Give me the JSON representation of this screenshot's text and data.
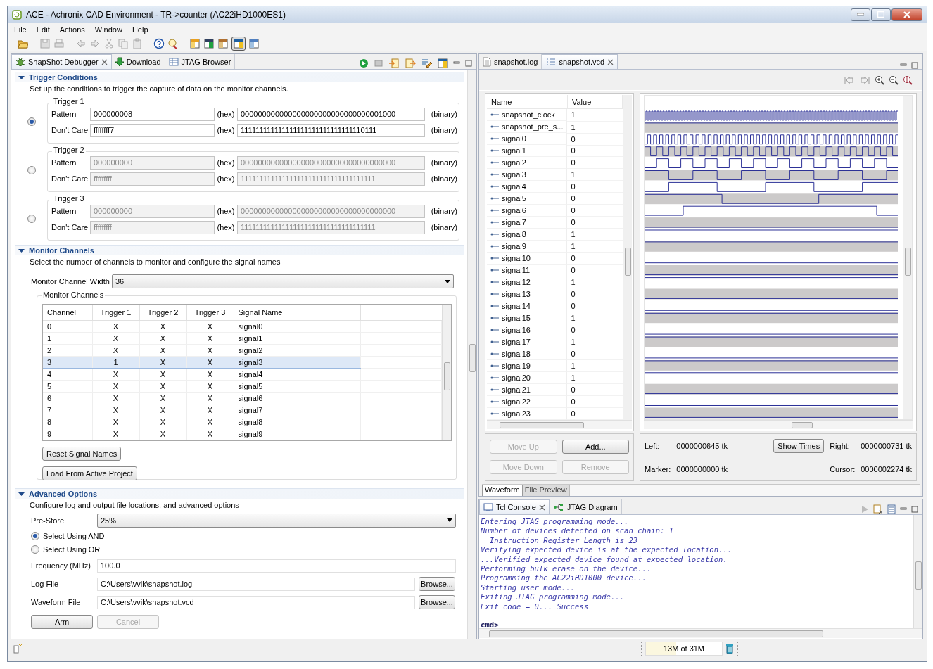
{
  "window": {
    "title": "ACE - Achronix CAD Environment - TR->counter (AC22iHD1000ES1)"
  },
  "menu": [
    "File",
    "Edit",
    "Actions",
    "Window",
    "Help"
  ],
  "left_tabs": [
    {
      "label": "SnapShot Debugger",
      "selected": true,
      "closable": true
    },
    {
      "label": "Download",
      "selected": false,
      "closable": false
    },
    {
      "label": "JTAG Browser",
      "selected": false,
      "closable": false
    }
  ],
  "trigger_conditions": {
    "title": "Trigger Conditions",
    "expanded": true,
    "description": "Set up the conditions to trigger the capture of data on the monitor channels.",
    "triggers": [
      {
        "label": "Trigger 1",
        "selected": true,
        "disabled": false,
        "rows": [
          {
            "label": "Pattern",
            "hex": "000000008",
            "hex_unit": "(hex)",
            "binary": "000000000000000000000000000000001000",
            "binary_unit": "(binary)"
          },
          {
            "label": "Don't Care",
            "hex": "ffffffff7",
            "hex_unit": "(hex)",
            "binary": "111111111111111111111111111111110111",
            "binary_unit": "(binary)"
          }
        ]
      },
      {
        "label": "Trigger 2",
        "selected": false,
        "disabled": true,
        "rows": [
          {
            "label": "Pattern",
            "hex": "000000000",
            "hex_unit": "(hex)",
            "binary": "000000000000000000000000000000000000",
            "binary_unit": "(binary)"
          },
          {
            "label": "Don't Care",
            "hex": "fffffffff",
            "hex_unit": "(hex)",
            "binary": "111111111111111111111111111111111111",
            "binary_unit": "(binary)"
          }
        ]
      },
      {
        "label": "Trigger 3",
        "selected": false,
        "disabled": true,
        "rows": [
          {
            "label": "Pattern",
            "hex": "000000000",
            "hex_unit": "(hex)",
            "binary": "000000000000000000000000000000000000",
            "binary_unit": "(binary)"
          },
          {
            "label": "Don't Care",
            "hex": "fffffffff",
            "hex_unit": "(hex)",
            "binary": "111111111111111111111111111111111111",
            "binary_unit": "(binary)"
          }
        ]
      }
    ]
  },
  "monitor_channels": {
    "title": "Monitor Channels",
    "expanded": true,
    "description": "Select the number of channels to monitor and configure the signal names",
    "width_label": "Monitor Channel Width",
    "width_value": "36",
    "group_title": "Monitor Channels",
    "table": {
      "columns": [
        "Channel",
        "Trigger 1",
        "Trigger 2",
        "Trigger 3",
        "Signal Name"
      ],
      "rows": [
        {
          "cells": [
            "0",
            "X",
            "X",
            "X",
            "signal0"
          ],
          "selected": false
        },
        {
          "cells": [
            "1",
            "X",
            "X",
            "X",
            "signal1"
          ],
          "selected": false
        },
        {
          "cells": [
            "2",
            "X",
            "X",
            "X",
            "signal2"
          ],
          "selected": false
        },
        {
          "cells": [
            "3",
            "1",
            "X",
            "X",
            "signal3"
          ],
          "selected": true
        },
        {
          "cells": [
            "4",
            "X",
            "X",
            "X",
            "signal4"
          ],
          "selected": false
        },
        {
          "cells": [
            "5",
            "X",
            "X",
            "X",
            "signal5"
          ],
          "selected": false
        },
        {
          "cells": [
            "6",
            "X",
            "X",
            "X",
            "signal6"
          ],
          "selected": false
        },
        {
          "cells": [
            "7",
            "X",
            "X",
            "X",
            "signal7"
          ],
          "selected": false
        },
        {
          "cells": [
            "8",
            "X",
            "X",
            "X",
            "signal8"
          ],
          "selected": false
        },
        {
          "cells": [
            "9",
            "X",
            "X",
            "X",
            "signal9"
          ],
          "selected": false
        }
      ]
    },
    "buttons": [
      "Reset Signal Names",
      "Load From Active Project"
    ]
  },
  "advanced_options": {
    "title": "Advanced Options",
    "expanded": true,
    "description": "Configure log and output file locations, and advanced options",
    "prestore_label": "Pre-Store",
    "prestore_value": "25%",
    "modes": [
      {
        "label": "Select Using AND",
        "selected": true
      },
      {
        "label": "Select Using OR",
        "selected": false
      }
    ],
    "fields": [
      {
        "label": "Frequency (MHz)",
        "value": "100.0"
      },
      {
        "label": "Log File",
        "value": "C:\\Users\\vvik\\snapshot.log",
        "button": "Browse..."
      },
      {
        "label": "Waveform File",
        "value": "C:\\Users\\vvik\\snapshot.vcd",
        "button": "Browse..."
      }
    ],
    "buttons": [
      {
        "label": "Arm",
        "disabled": false
      },
      {
        "label": "Cancel",
        "disabled": true
      }
    ]
  },
  "editor_tabs": [
    {
      "label": "snapshot.log",
      "selected": false,
      "closable": false
    },
    {
      "label": "snapshot.vcd",
      "selected": true,
      "closable": true
    }
  ],
  "signals": {
    "columns": [
      "Name",
      "Value"
    ],
    "rows": [
      {
        "name": "snapshot_clock",
        "value": "1"
      },
      {
        "name": "snapshot_pre_s...",
        "value": "1"
      },
      {
        "name": "signal0",
        "value": "0"
      },
      {
        "name": "signal1",
        "value": "0"
      },
      {
        "name": "signal2",
        "value": "0"
      },
      {
        "name": "signal3",
        "value": "1"
      },
      {
        "name": "signal4",
        "value": "0"
      },
      {
        "name": "signal5",
        "value": "0"
      },
      {
        "name": "signal6",
        "value": "0"
      },
      {
        "name": "signal7",
        "value": "0"
      },
      {
        "name": "signal8",
        "value": "1"
      },
      {
        "name": "signal9",
        "value": "1"
      },
      {
        "name": "signal10",
        "value": "0"
      },
      {
        "name": "signal11",
        "value": "0"
      },
      {
        "name": "signal12",
        "value": "1"
      },
      {
        "name": "signal13",
        "value": "0"
      },
      {
        "name": "signal14",
        "value": "0"
      },
      {
        "name": "signal15",
        "value": "1"
      },
      {
        "name": "signal16",
        "value": "0"
      },
      {
        "name": "signal17",
        "value": "1"
      },
      {
        "name": "signal18",
        "value": "0"
      },
      {
        "name": "signal19",
        "value": "1"
      },
      {
        "name": "signal20",
        "value": "1"
      },
      {
        "name": "signal21",
        "value": "0"
      },
      {
        "name": "signal22",
        "value": "0"
      },
      {
        "name": "signal23",
        "value": "0"
      }
    ]
  },
  "signal_buttons": [
    {
      "label": "Move Up",
      "disabled": true
    },
    {
      "label": "Add...",
      "disabled": false
    },
    {
      "label": "Move Down",
      "disabled": true
    },
    {
      "label": "Remove",
      "disabled": true
    }
  ],
  "times": {
    "left_label": "Left:",
    "left": "0000000645 tk",
    "button": "Show Times",
    "right_label": "Right:",
    "right": "0000000731 tk",
    "marker_label": "Marker:",
    "marker": "0000000000 tk",
    "cursor_label": "Cursor:",
    "cursor": "0000002274 tk"
  },
  "view_tabs": [
    {
      "label": "Waveform",
      "selected": true
    },
    {
      "label": "File Preview",
      "selected": false
    }
  ],
  "console_tabs": [
    {
      "label": "Tcl Console",
      "selected": true,
      "closable": true
    },
    {
      "label": "JTAG Diagram",
      "selected": false,
      "closable": false
    }
  ],
  "console": {
    "lines": [
      "Entering JTAG programming mode...",
      "Number of devices detected on scan chain: 1",
      "  Instruction Register Length is 23",
      "Verifying expected device is at the expected location...",
      "...Verified expected device found at expected location.",
      "Performing bulk erase on the device...",
      "Programming the AC22iHD1000 device...",
      "Starting user mode...",
      "Exiting JTAG programming mode...",
      "Exit code = 0... Success"
    ],
    "prompt": "cmd>"
  },
  "status": {
    "memory": "13M of 31M"
  }
}
